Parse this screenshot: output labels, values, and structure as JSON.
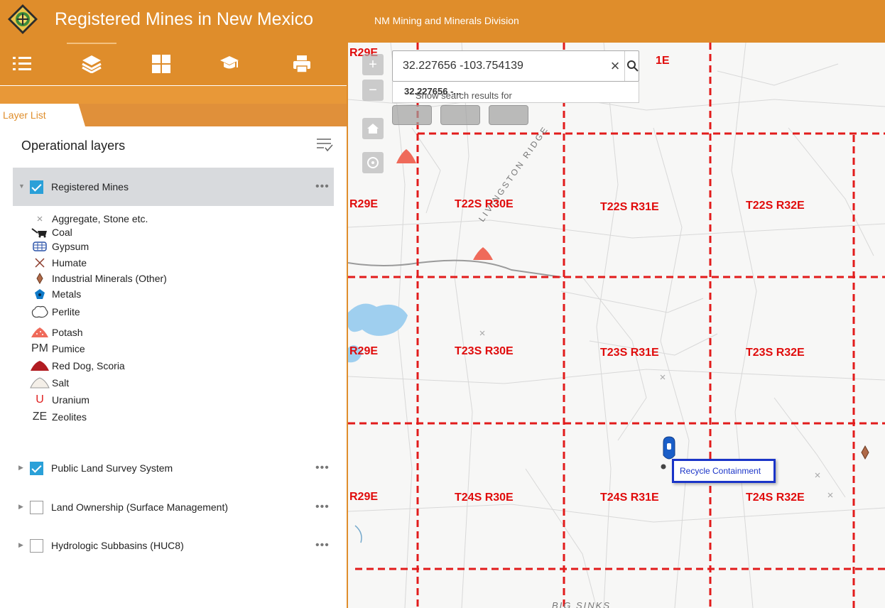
{
  "header": {
    "title": "Registered Mines in New Mexico",
    "subtitle": "NM Mining and Minerals Division",
    "bg_color": "#df8d2b"
  },
  "toolbar": {
    "tools": [
      "legend-icon",
      "layers-icon",
      "basemap-gallery-icon",
      "about-icon",
      "print-icon"
    ]
  },
  "panel": {
    "tab_label": "Layer List",
    "section_title": "Operational layers",
    "layers": [
      {
        "label": "Registered Mines",
        "checked": true,
        "expanded": true
      },
      {
        "label": "Public Land Survey System",
        "checked": true,
        "expanded": false
      },
      {
        "label": "Land Ownership (Surface Management)",
        "checked": false,
        "expanded": false
      },
      {
        "label": "Hydrologic Subbasins (HUC8)",
        "checked": false,
        "expanded": false
      }
    ],
    "legend": [
      {
        "label": "Aggregate, Stone etc.",
        "icon": "x-mark-icon",
        "sym": ""
      },
      {
        "label": "Coal",
        "icon": "coal-cart-icon",
        "sym": ""
      },
      {
        "label": "Gypsum",
        "icon": "gypsum-icon",
        "sym": ""
      },
      {
        "label": "Humate",
        "icon": "humate-icon",
        "sym": ""
      },
      {
        "label": "Industrial Minerals (Other)",
        "icon": "diamond-icon",
        "sym": ""
      },
      {
        "label": "Metals",
        "icon": "pentagon-icon",
        "sym": ""
      },
      {
        "label": "Perlite",
        "icon": "perlite-icon",
        "sym": ""
      },
      {
        "label": "Potash",
        "icon": "potash-pile-icon",
        "sym": ""
      },
      {
        "label": "Pumice",
        "icon": "pumice-icon",
        "sym": "PM"
      },
      {
        "label": "Red Dog, Scoria",
        "icon": "scoria-pile-icon",
        "sym": ""
      },
      {
        "label": "Salt",
        "icon": "salt-pile-icon",
        "sym": ""
      },
      {
        "label": "Uranium",
        "icon": "uranium-icon",
        "sym": "U"
      },
      {
        "label": "Zeolites",
        "icon": "zeolite-icon",
        "sym": "ZE"
      }
    ]
  },
  "map": {
    "search_value": "32.227656 -103.754139",
    "suggest_prefix": "Show search results for ",
    "suggest_bold": "32.227656 -...",
    "popup_label": "Recycle Containment",
    "place_label_1": "LIVINGSTON RIDGE",
    "place_label_2": "BIG SINKS",
    "townships": {
      "r29_top": "R29E",
      "r31_top": "1E",
      "r29_1": "R29E",
      "t22_30": "T22S R30E",
      "t22_31": "T22S R31E",
      "t22_32": "T22S R32E",
      "r29_2": "R29E",
      "t23_30": "T23S R30E",
      "t23_31": "T23S R31E",
      "t23_32": "T23S R32E",
      "r29_3": "R29E",
      "t24_30": "T24S R30E",
      "t24_31": "T24S R31E",
      "t24_32": "T24S R32E"
    }
  }
}
